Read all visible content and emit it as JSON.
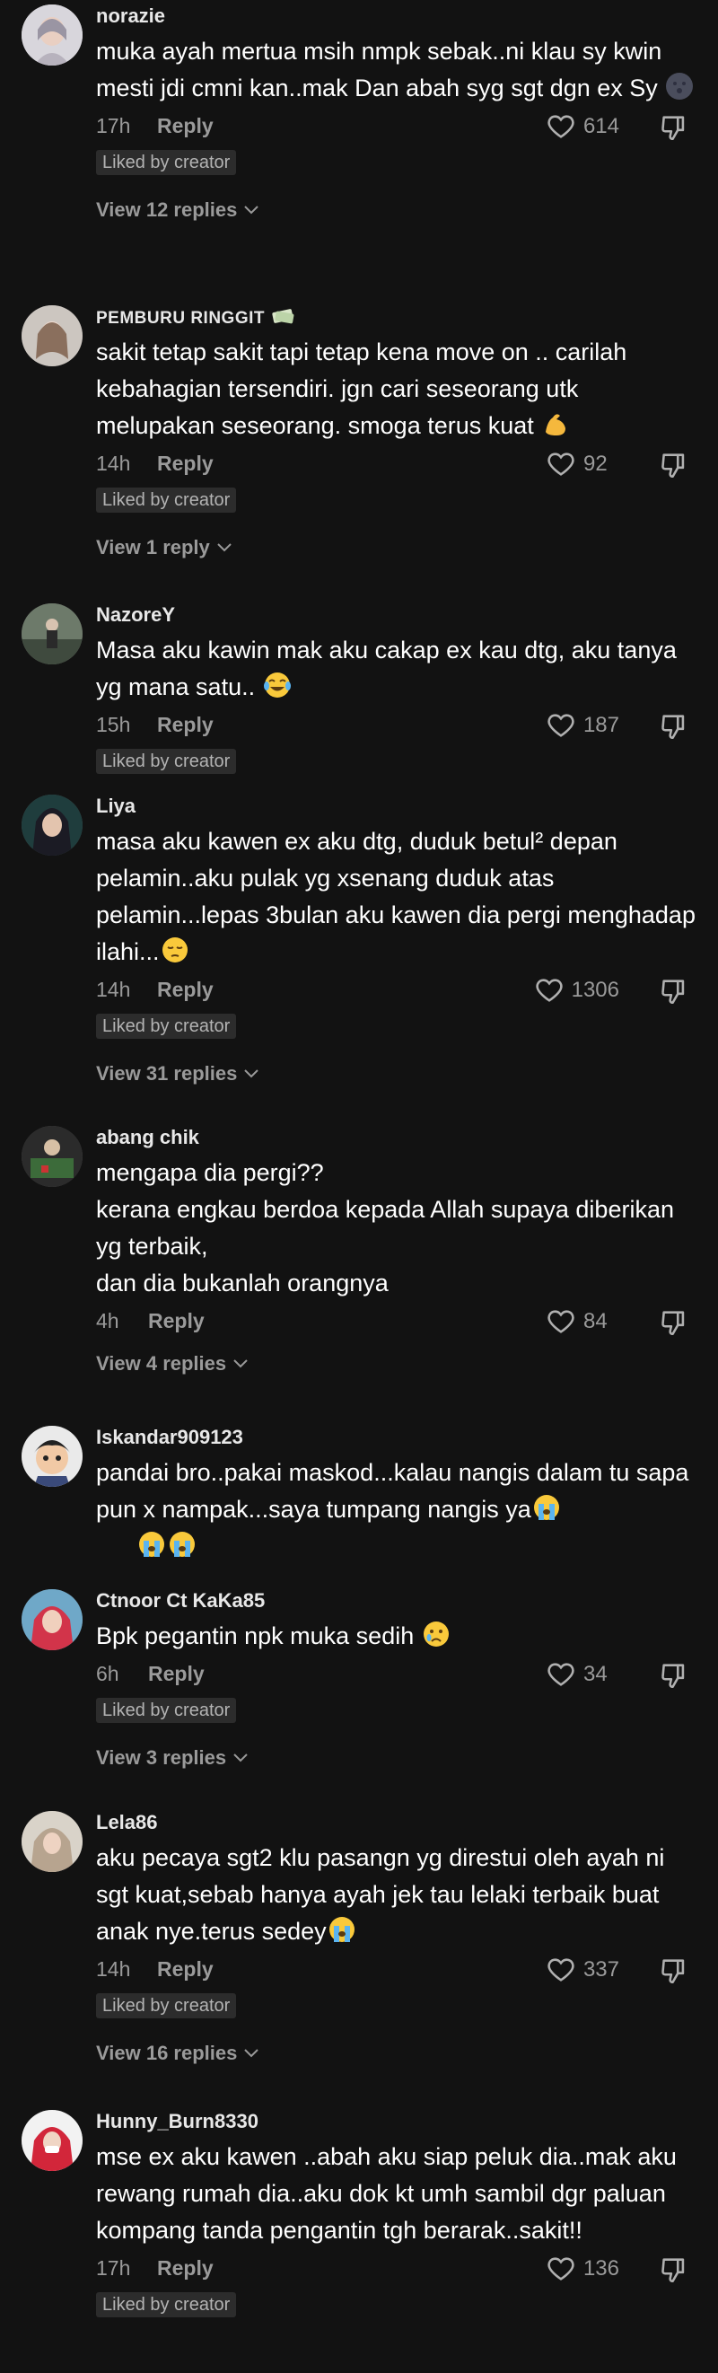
{
  "comments": [
    {
      "user": "norazie",
      "text": "muka ayah mertua msih nmpk sebak..ni klau sy kwin mesti jdi cmni kan..mak Dan abah syg sgt dgn ex Sy",
      "time": "17h",
      "reply": "Reply",
      "likes": "614",
      "liked_by": "Liked by creator",
      "view_replies": "View 12 replies"
    },
    {
      "user": "PEMBURU RINGGIT",
      "text": "sakit tetap sakit tapi tetap kena move on .. carilah kebahagian tersendiri. jgn cari seseorang utk melupakan seseorang. smoga terus kuat",
      "time": "14h",
      "reply": "Reply",
      "likes": "92",
      "liked_by": "Liked by creator",
      "view_replies": "View 1 reply"
    },
    {
      "user": "NazoreY",
      "text": "Masa aku kawin mak aku cakap ex kau dtg, aku tanya yg mana satu..",
      "time": "15h",
      "reply": "Reply",
      "likes": "187",
      "liked_by": "Liked by creator",
      "view_replies": ""
    },
    {
      "user": "Liya",
      "text": "masa aku kawen ex aku dtg, duduk betul² depan pelamin..aku pulak yg xsenang duduk atas pelamin...lepas 3bulan aku kawen dia pergi menghadap ilahi...",
      "time": "14h",
      "reply": "Reply",
      "likes": "1306",
      "liked_by": "Liked by creator",
      "view_replies": "View 31 replies"
    },
    {
      "user": "abang chik",
      "text": "mengapa dia pergi??\nkerana engkau berdoa kepada Allah supaya diberikan yg terbaik,\ndan dia bukanlah orangnya",
      "time": "4h",
      "reply": "Reply",
      "likes": "84",
      "liked_by": "",
      "view_replies": "View 4 replies"
    },
    {
      "user": "Iskandar909123",
      "text": "pandai bro..pakai maskod...kalau nangis dalam tu sapa pun x nampak...saya tumpang nangis ya",
      "time": "",
      "reply": "",
      "likes": "",
      "liked_by": "",
      "view_replies": ""
    },
    {
      "user": "Ctnoor Ct KaKa85",
      "text": "Bpk pegantin npk muka sedih",
      "time": "6h",
      "reply": "Reply",
      "likes": "34",
      "liked_by": "Liked by creator",
      "view_replies": "View 3 replies"
    },
    {
      "user": "Lela86",
      "text": "aku pecaya sgt2 klu pasangn yg direstui oleh ayah ni sgt kuat,sebab hanya ayah jek tau lelaki terbaik buat anak nye.terus sedey",
      "time": "14h",
      "reply": "Reply",
      "likes": "337",
      "liked_by": "Liked by creator",
      "view_replies": "View 16 replies"
    },
    {
      "user": "Hunny_Burn8330",
      "text": "mse ex aku kawen ..abah aku siap peluk dia..mak aku rewang rumah dia..aku dok kt umh sambil dgr paluan kompang tanda pengantin tgh berarak..sakit!!",
      "time": "17h",
      "reply": "Reply",
      "likes": "136",
      "liked_by": "Liked by creator",
      "view_replies": ""
    }
  ],
  "colors": {
    "background": "#121212",
    "muted": "#9a9a9a",
    "badge": "#2c2c2c"
  }
}
